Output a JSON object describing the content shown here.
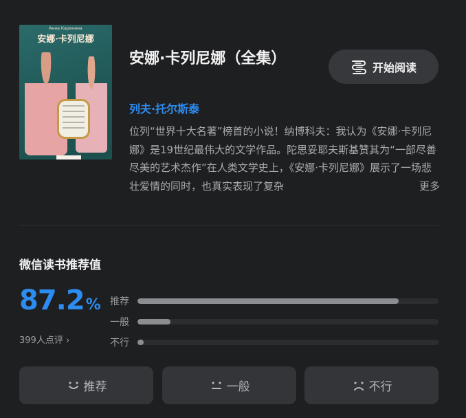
{
  "book": {
    "title": "安娜·卡列尼娜（全集）",
    "author": "列夫·托尔斯泰",
    "description": "位列“世界十大名著”榜首的小说！纳博科夫：我认为《安娜·卡列尼娜》是19世纪最伟大的文学作品。陀思妥耶夫斯基赞其为“一部尽善尽美的艺术杰作”在人类文学史上，《安娜·卡列尼娜》展示了一场悲壮爱情的同时，也真实表现了复杂",
    "more_label": "更多",
    "cover": {
      "title": "安娜·卡列尼娜",
      "subtitle": "Анна Каренина"
    }
  },
  "actions": {
    "read_label": "开始阅读"
  },
  "rating": {
    "heading": "微信读书推荐值",
    "score": "87.2",
    "unit": "%",
    "review_count": "399人点评",
    "review_arrow": "›",
    "bars": [
      {
        "label": "推荐",
        "fraction": 0.868
      },
      {
        "label": "一般",
        "fraction": 0.11
      },
      {
        "label": "不行",
        "fraction": 0.02
      }
    ]
  },
  "vote_buttons": [
    {
      "label": "推荐",
      "icon": "smile-icon"
    },
    {
      "label": "一般",
      "icon": "neutral-face-icon"
    },
    {
      "label": "不行",
      "icon": "frown-icon"
    }
  ],
  "colors": {
    "background": "#1e1f21",
    "accent": "#2d8cf0",
    "button": "#333539"
  }
}
